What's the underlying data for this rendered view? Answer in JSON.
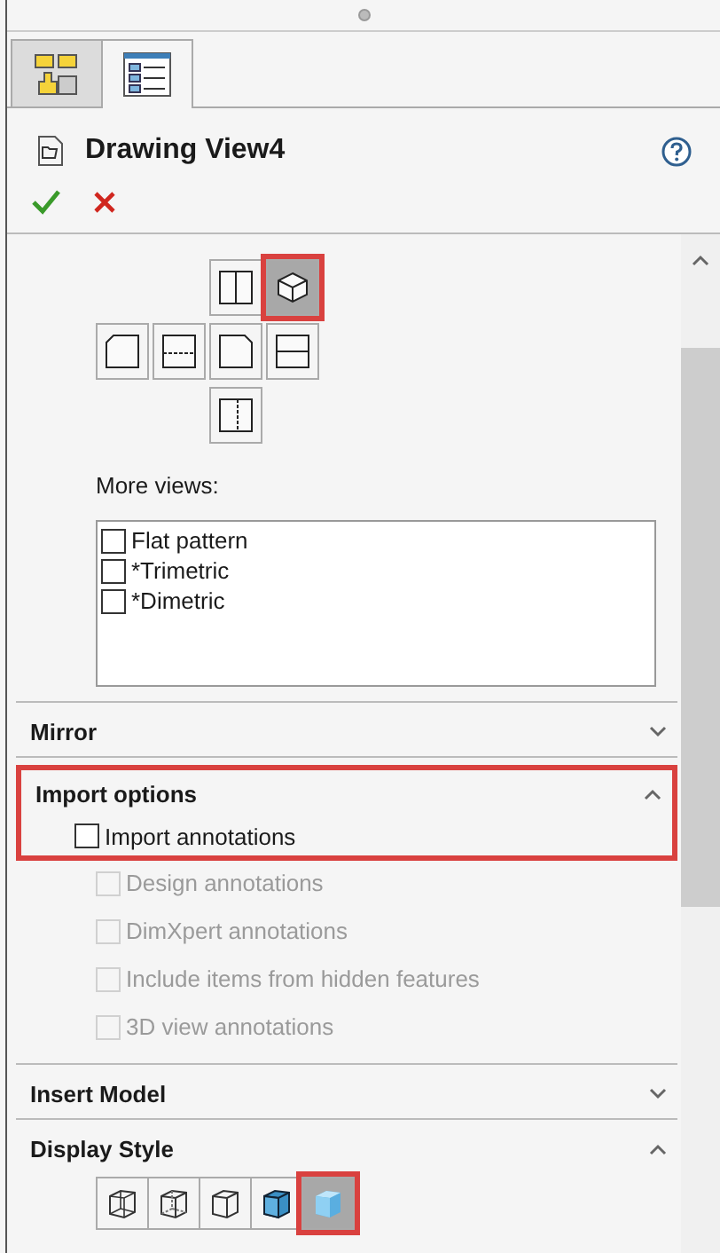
{
  "tabs": [
    {
      "kind": "feature-manager",
      "selected": false
    },
    {
      "kind": "property-manager",
      "selected": true
    }
  ],
  "header": {
    "title": "Drawing View4"
  },
  "views": [
    {
      "kind": "split-v",
      "selected": false,
      "highlighted": false
    },
    {
      "kind": "iso",
      "selected": true,
      "highlighted": true
    },
    {
      "kind": "corner-left",
      "selected": false,
      "highlighted": false
    },
    {
      "kind": "dash-h",
      "selected": false,
      "highlighted": false
    },
    {
      "kind": "corner-right",
      "selected": false,
      "highlighted": false
    },
    {
      "kind": "split-h",
      "selected": false,
      "highlighted": false
    },
    {
      "kind": "dash-v",
      "selected": false,
      "highlighted": false
    }
  ],
  "more_views": {
    "label": "More views:",
    "items": [
      {
        "label": "Flat pattern",
        "checked": false
      },
      {
        "label": "*Trimetric",
        "checked": false
      },
      {
        "label": "*Dimetric",
        "checked": false
      }
    ]
  },
  "sections": [
    {
      "title": "Mirror",
      "expanded": false,
      "highlighted": false
    },
    {
      "title": "Import options",
      "expanded": true,
      "highlighted": true,
      "main_option": {
        "label": "Import annotations",
        "checked": false
      },
      "options": [
        {
          "label": "Design annotations",
          "checked": false,
          "disabled": true
        },
        {
          "label": "DimXpert annotations",
          "checked": false,
          "disabled": true
        },
        {
          "label": "Include items from hidden features",
          "checked": false,
          "disabled": true
        },
        {
          "label": "3D view annotations",
          "checked": false,
          "disabled": true
        }
      ]
    },
    {
      "title": "Insert Model",
      "expanded": false,
      "highlighted": false
    },
    {
      "title": "Display Style",
      "expanded": true,
      "highlighted": false,
      "styles": [
        {
          "kind": "wireframe",
          "selected": false,
          "highlighted": false
        },
        {
          "kind": "hidden-visible",
          "selected": false,
          "highlighted": false
        },
        {
          "kind": "hidden-removed",
          "selected": false,
          "highlighted": false
        },
        {
          "kind": "shaded-edges",
          "selected": false,
          "highlighted": false
        },
        {
          "kind": "shaded",
          "selected": true,
          "highlighted": true
        }
      ]
    }
  ]
}
